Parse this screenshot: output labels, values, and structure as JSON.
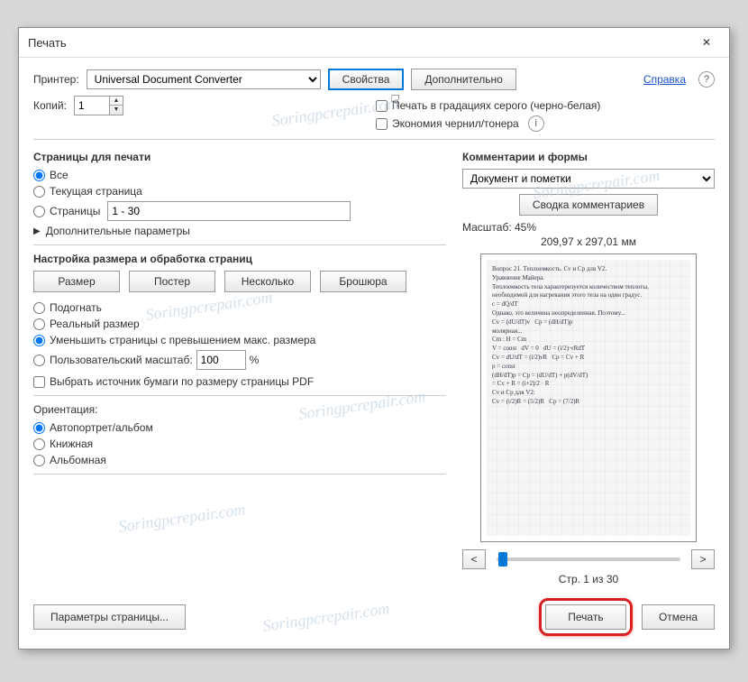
{
  "title": "Печать",
  "printer_label": "Принтер:",
  "printer_value": "Universal Document Converter",
  "properties_btn": "Свойства",
  "advanced_btn": "Дополнительно",
  "help_link": "Справка",
  "copies_label": "Копий:",
  "copies_value": "1",
  "grayscale_cb": "Печать в градациях серого (черно-белая)",
  "ink_cb": "Экономия чернил/тонера",
  "pages_header": "Страницы для печати",
  "radio_all": "Все",
  "radio_current": "Текущая страница",
  "radio_pages": "Страницы",
  "pages_range": "1 - 30",
  "more_params": "Дополнительные параметры",
  "size_header": "Настройка размера и обработка страниц",
  "btn_size": "Размер",
  "btn_poster": "Постер",
  "btn_multiple": "Несколько",
  "btn_booklet": "Брошюра",
  "radio_fit": "Подогнать",
  "radio_actual": "Реальный размер",
  "radio_shrink": "Уменьшить страницы с превышением макс. размера",
  "radio_custom": "Пользовательский масштаб:",
  "custom_scale_value": "100",
  "custom_scale_pct": "%",
  "cb_paper_source": "Выбрать источник бумаги по размеру страницы PDF",
  "orientation_label": "Ориентация:",
  "radio_auto": "Автопортрет/альбом",
  "radio_portrait": "Книжная",
  "radio_landscape": "Альбомная",
  "comments_header": "Комментарии и формы",
  "comments_select": "Документ и пометки",
  "summary_btn": "Сводка комментариев",
  "scale_label": "Масштаб: 45%",
  "dimensions": "209,97 x 297,01 мм",
  "page_of": "Стр. 1 из 30",
  "page_setup_btn": "Параметры страницы...",
  "print_btn": "Печать",
  "cancel_btn": "Отмена",
  "watermark": "Soringpcrepair.com"
}
